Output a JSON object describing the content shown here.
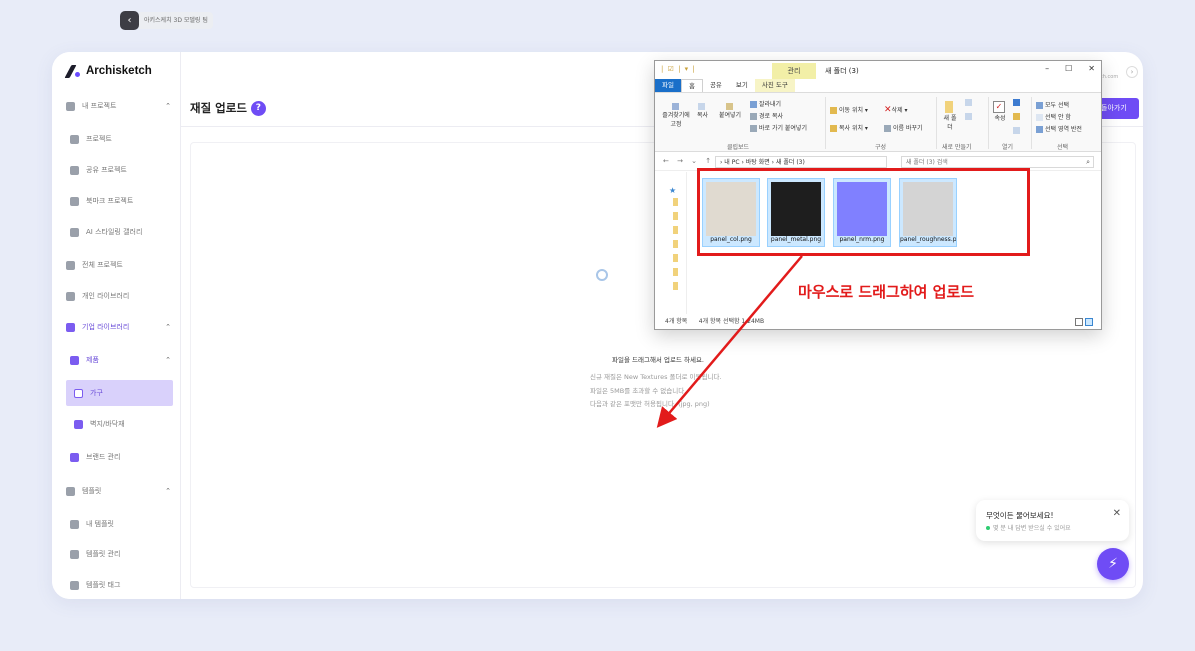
{
  "app": {
    "brand": "Archisketch",
    "breadcrumb": "아키스케치 3D 모델링 팀",
    "site_text": "ch.com",
    "back_label": "돌아가기",
    "page_title": "재질 업로드",
    "help": "?"
  },
  "sidebar": {
    "items": [
      {
        "label": "내 프로젝트",
        "chev": "⌃"
      },
      {
        "label": "프로젝트"
      },
      {
        "label": "공유 프로젝트"
      },
      {
        "label": "북마크 프로젝트"
      },
      {
        "label": "AI 스타일링 갤러리"
      },
      {
        "label": "전체 프로젝트"
      },
      {
        "label": "개인 라이브러리"
      },
      {
        "label": "기업 라이브러리",
        "chev": "⌃"
      },
      {
        "label": "제품",
        "chev": "⌃"
      },
      {
        "label": "가구"
      },
      {
        "label": "벽지/바닥재"
      },
      {
        "label": "브랜드 관리"
      },
      {
        "label": "템플릿",
        "chev": "⌃"
      },
      {
        "label": "내 템플릿"
      },
      {
        "label": "템플릿 관리"
      },
      {
        "label": "템플릿 태그"
      }
    ]
  },
  "upload": {
    "title": "파일을 드래그해서 업로드 하세요.",
    "note1": "신규 재질은 New Textures 폴더로 이동됩니다.",
    "note2": "파일은 5MB를 초과할 수 없습니다.",
    "note3": "다음과 같은 포맷만 허용됩니다. (jpg, png)"
  },
  "chat": {
    "question": "무엇이든 물어보세요!",
    "status": "몇 분 내 답변 받으실 수 있어요",
    "close": "✕"
  },
  "explorer": {
    "quick_access": "| ☑ | ▾ |",
    "manage_tab": "관리",
    "window_title": "새 폴더 (3)",
    "min": "–",
    "max": "☐",
    "close": "✕",
    "tabs": [
      "파일",
      "홈",
      "공유",
      "보기",
      "사진 도구"
    ],
    "ribbon": {
      "pin": "즐겨찾기에 고정",
      "copy": "복사",
      "paste": "붙여넣기",
      "cut": "잘라내기",
      "copy_path": "경로 복사",
      "paste_shortcut": "바로 가기 붙여넣기",
      "move_to": "이동 위치 ▾",
      "copy_to": "복사 위치 ▾",
      "delete": "삭제 ▾",
      "rename": "이름 바꾸기",
      "new_folder": "새 폴더",
      "properties": "속성",
      "select_all": "모두 선택",
      "select_none": "선택 안 함",
      "invert": "선택 영역 반전",
      "groups": [
        "클립보드",
        "구성",
        "새로 만들기",
        "열기",
        "선택"
      ]
    },
    "nav_arrows": "← → ⌄ ↑",
    "path": "› 내 PC › 바탕 화면 › 새 폴더 (3)",
    "search_placeholder": "새 폴더 (3) 검색",
    "search_icon": "⌕",
    "files": [
      {
        "name": "panel_col.png",
        "color": "#e0dad0"
      },
      {
        "name": "panel_metal.png",
        "color": "#1e1e1e"
      },
      {
        "name": "panel_nrm.png",
        "color": "#8080ff"
      },
      {
        "name": "panel_roughness.png",
        "color": "#d4d4d4"
      }
    ],
    "status_count": "4개 항목",
    "status_selected": "4개 항목 선택함 1.24MB"
  },
  "annotation": {
    "text": "마우스로 드래그하여 업로드",
    "color": "#e21b1b"
  },
  "colors": {
    "accent": "#6f4cf5",
    "active_bg": "#d9d1fb"
  }
}
